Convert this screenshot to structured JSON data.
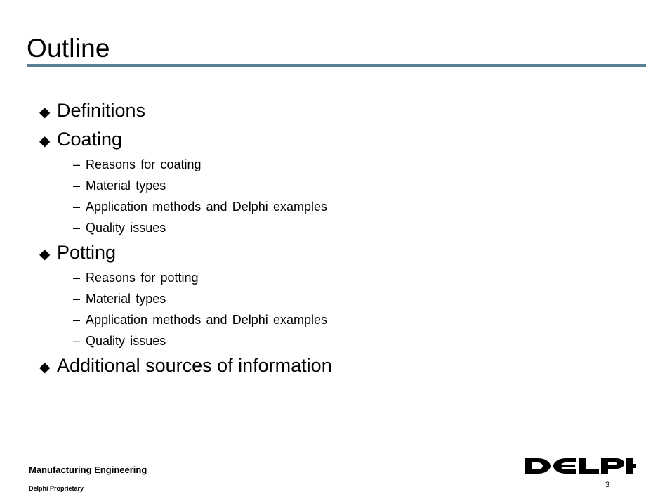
{
  "slide": {
    "title": "Outline",
    "page_number": "3",
    "accent_color": "#5b7f95",
    "background_color": "#ffffff",
    "text_color": "#000000"
  },
  "outline": {
    "items": [
      {
        "level": 1,
        "marker": "◆",
        "text": "Definitions"
      },
      {
        "level": 1,
        "marker": "◆",
        "text": "Coating"
      },
      {
        "level": 2,
        "marker": "–",
        "text": "Reasons for coating"
      },
      {
        "level": 2,
        "marker": "–",
        "text": "Material types"
      },
      {
        "level": 2,
        "marker": "–",
        "text": "Application methods and Delphi examples"
      },
      {
        "level": 2,
        "marker": "–",
        "text": "Quality issues"
      },
      {
        "level": 1,
        "marker": "◆",
        "text": "Potting"
      },
      {
        "level": 2,
        "marker": "–",
        "text": "Reasons for potting"
      },
      {
        "level": 2,
        "marker": "–",
        "text": "Material types"
      },
      {
        "level": 2,
        "marker": "–",
        "text": "Application methods and Delphi examples"
      },
      {
        "level": 2,
        "marker": "–",
        "text": "Quality issues"
      },
      {
        "level": 1,
        "marker": "◆",
        "text": "Additional sources of information"
      }
    ]
  },
  "footer": {
    "department": "Manufacturing Engineering",
    "confidentiality": "Delphi Proprietary",
    "logo_text": "DELPHI"
  }
}
